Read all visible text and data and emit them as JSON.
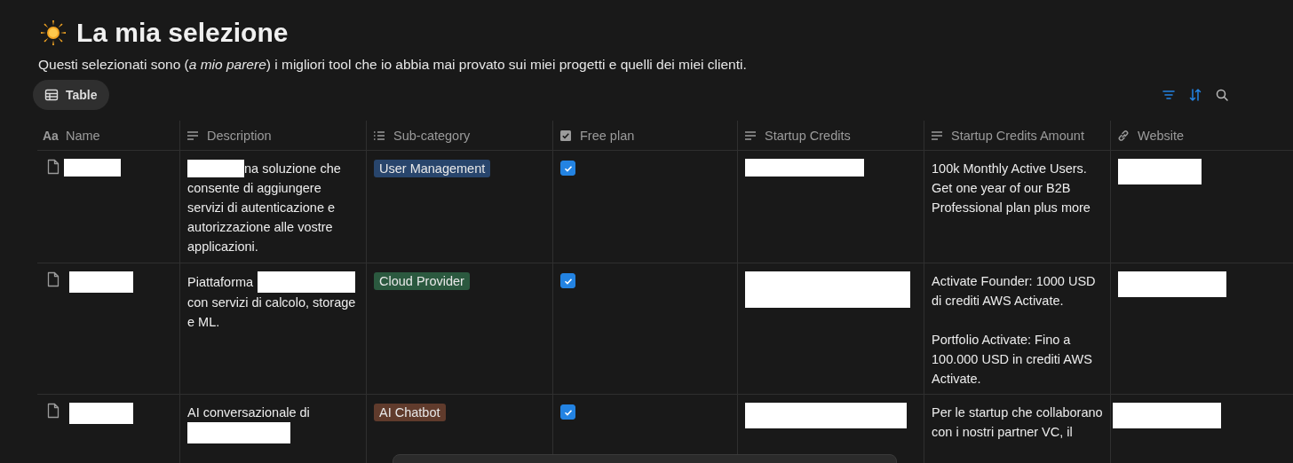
{
  "page": {
    "title": "La mia selezione",
    "intro": "Questi selezionati sono (*a mio parere*) i migliori tool che io abbia mai provato sui miei progetti e quelli dei miei clienti."
  },
  "view_tab": {
    "label": "Table",
    "selected": true
  },
  "columns": [
    {
      "kind": "title",
      "label": "Name",
      "icon_text": "Aa"
    },
    {
      "kind": "text",
      "label": "Description"
    },
    {
      "kind": "multi",
      "label": "Sub-category"
    },
    {
      "kind": "checkbox",
      "label": "Free plan"
    },
    {
      "kind": "text",
      "label": "Startup Credits"
    },
    {
      "kind": "text",
      "label": "Startup Credits Amount"
    },
    {
      "kind": "url",
      "label": "Website"
    }
  ],
  "rows": [
    {
      "description": [
        [
          {
            "kind": "redaction"
          },
          {
            "kind": "text",
            "text": "na soluzione che"
          }
        ],
        [
          {
            "kind": "text",
            "text": "consente di aggiungere servizi di autenticazione e autorizzazione alle vostre applicazioni."
          }
        ]
      ],
      "sub_category": {
        "label": "User Management",
        "color": "#28456c"
      },
      "free_plan": {
        "checked": true
      },
      "credits_amount": [
        "100k Monthly Active Users. Get one year of our B2B Professional plan plus more"
      ]
    },
    {
      "description": [
        [
          {
            "kind": "text",
            "text": "Piattaforma"
          },
          {
            "kind": "redaction"
          }
        ],
        [
          {
            "kind": "text",
            "text": "con servizi di calcolo, storage e ML."
          }
        ]
      ],
      "sub_category": {
        "label": "Cloud Provider",
        "color": "#2b593f"
      },
      "free_plan": {
        "checked": true
      },
      "credits_amount": [
        "Activate Founder: 1000 USD di crediti AWS Activate.",
        "Portfolio Activate: Fino a 100.000 USD in crediti AWS Activate."
      ]
    },
    {
      "description": [
        [
          {
            "kind": "text",
            "text": "AI conversazionale di"
          }
        ],
        [
          {
            "kind": "redaction"
          }
        ]
      ],
      "sub_category": {
        "label": "AI Chatbot",
        "color": "#603b2c"
      },
      "free_plan": {
        "checked": true
      },
      "credits_amount": [
        "Per le startup che collaborano con i nostri partner VC, il"
      ]
    }
  ]
}
